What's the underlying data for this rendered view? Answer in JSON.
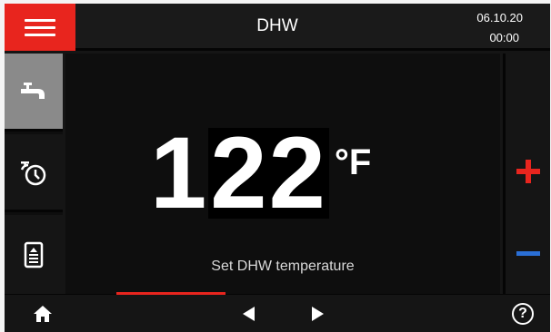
{
  "header": {
    "title": "DHW",
    "date": "06.10.20",
    "time": "00:00",
    "accent_color": "#e8251e"
  },
  "sidebar": {
    "items": [
      {
        "icon": "water-tap-icon",
        "active": true
      },
      {
        "icon": "timer-program-icon",
        "active": false
      },
      {
        "icon": "storage-tank-icon",
        "active": false
      }
    ]
  },
  "main": {
    "temperature_value": "1",
    "temperature_value_selected": "22",
    "unit": "°F",
    "caption": "Set DHW temperature"
  },
  "controls": {
    "increase_icon": "plus-icon",
    "increase_color": "#e8251e",
    "decrease_icon": "minus-icon",
    "decrease_color": "#2a6fd6"
  },
  "footer": {
    "home_icon": "home-icon",
    "prev_icon": "arrow-left-icon",
    "next_icon": "arrow-right-icon",
    "help_label": "?",
    "page_progress_fraction": 0.25
  }
}
